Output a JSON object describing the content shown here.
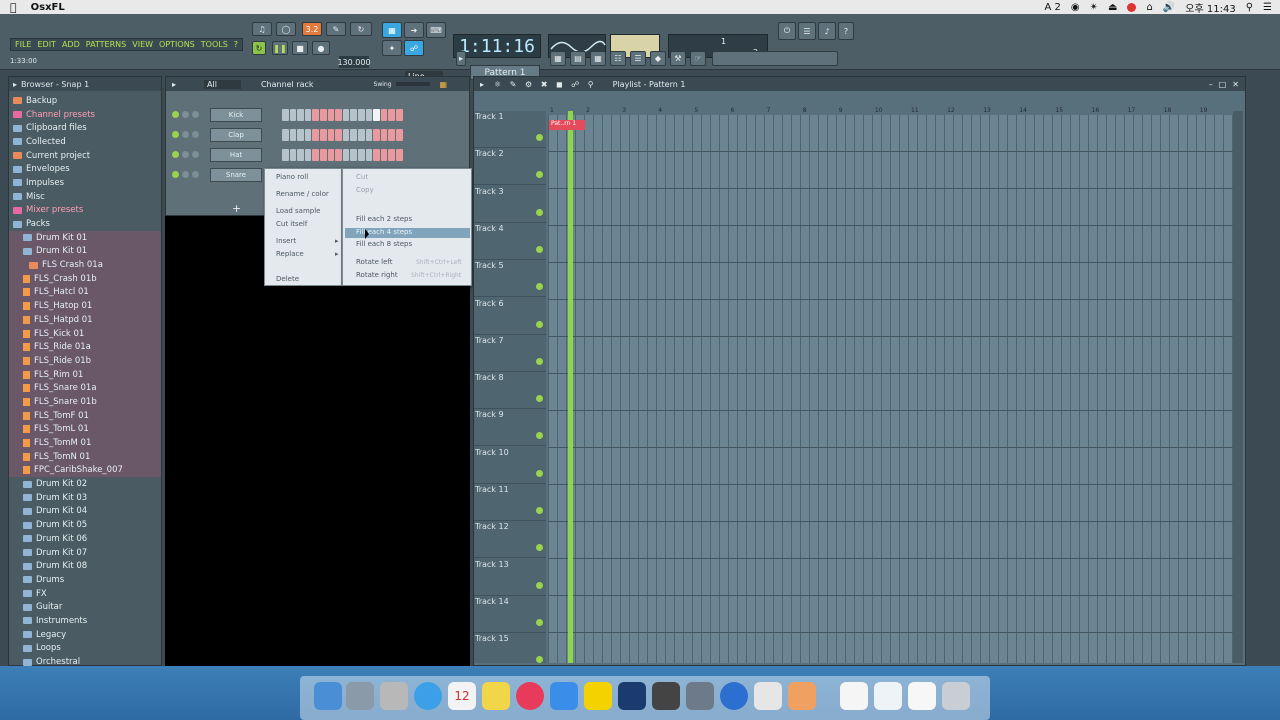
{
  "menubar": {
    "app_name": "OsxFL",
    "status_text": "A 2",
    "clock": "오후 11:43"
  },
  "toolbar": {
    "menu": [
      "FILE",
      "EDIT",
      "ADD",
      "PATTERNS",
      "VIEW",
      "OPTIONS",
      "TOOLS",
      "?"
    ],
    "hint": "1:33:00",
    "time": "1:11:16",
    "tempo": "130.000",
    "pattern": "Pattern 1",
    "snap": "Line",
    "cpu_digits": [
      "1",
      "2"
    ]
  },
  "browser": {
    "title": "Browser - Snap 1",
    "items": [
      {
        "label": "Backup",
        "type": "folder-o"
      },
      {
        "label": "Channel presets",
        "type": "folder-p",
        "hl": true
      },
      {
        "label": "Clipboard files",
        "type": "folder"
      },
      {
        "label": "Collected",
        "type": "folder"
      },
      {
        "label": "Current project",
        "type": "folder-o"
      },
      {
        "label": "Envelopes",
        "type": "folder"
      },
      {
        "label": "Impulses",
        "type": "folder"
      },
      {
        "label": "Misc",
        "type": "folder"
      },
      {
        "label": "Mixer presets",
        "type": "folder-p",
        "hl": true
      },
      {
        "label": "Packs",
        "type": "folder"
      },
      {
        "label": "Drum Kit 01",
        "type": "folder",
        "sub": 1,
        "pink": true
      },
      {
        "label": "Drum Kit 01",
        "type": "folder",
        "sub": 1,
        "pink": true
      },
      {
        "label": "FLS Crash 01a",
        "type": "folder-o",
        "sub": 2,
        "pink": true
      },
      {
        "label": "FLS_Crash 01b",
        "type": "sample",
        "sub": 1,
        "pink": true
      },
      {
        "label": "FLS_Hatcl 01",
        "type": "sample",
        "sub": 1,
        "pink": true
      },
      {
        "label": "FLS_Hatop 01",
        "type": "sample",
        "sub": 1,
        "pink": true
      },
      {
        "label": "FLS_Hatpd 01",
        "type": "sample",
        "sub": 1,
        "pink": true
      },
      {
        "label": "FLS_Kick 01",
        "type": "sample",
        "sub": 1,
        "pink": true
      },
      {
        "label": "FLS_Ride 01a",
        "type": "sample",
        "sub": 1,
        "pink": true
      },
      {
        "label": "FLS_Ride 01b",
        "type": "sample",
        "sub": 1,
        "pink": true
      },
      {
        "label": "FLS_Rim 01",
        "type": "sample",
        "sub": 1,
        "pink": true
      },
      {
        "label": "FLS_Snare 01a",
        "type": "sample",
        "sub": 1,
        "pink": true
      },
      {
        "label": "FLS_Snare 01b",
        "type": "sample",
        "sub": 1,
        "pink": true
      },
      {
        "label": "FLS_TomF 01",
        "type": "sample",
        "sub": 1,
        "pink": true
      },
      {
        "label": "FLS_TomL 01",
        "type": "sample",
        "sub": 1,
        "pink": true
      },
      {
        "label": "FLS_TomM 01",
        "type": "sample",
        "sub": 1,
        "pink": true
      },
      {
        "label": "FLS_TomN 01",
        "type": "sample",
        "sub": 1,
        "pink": true
      },
      {
        "label": "FPC_CaribShake_007",
        "type": "sample",
        "sub": 1,
        "pink": true
      },
      {
        "label": "Drum Kit 02",
        "type": "folder",
        "sub": 1
      },
      {
        "label": "Drum Kit 03",
        "type": "folder",
        "sub": 1
      },
      {
        "label": "Drum Kit 04",
        "type": "folder",
        "sub": 1
      },
      {
        "label": "Drum Kit 05",
        "type": "folder",
        "sub": 1
      },
      {
        "label": "Drum Kit 06",
        "type": "folder",
        "sub": 1
      },
      {
        "label": "Drum Kit 07",
        "type": "folder",
        "sub": 1
      },
      {
        "label": "Drum Kit 08",
        "type": "folder",
        "sub": 1
      },
      {
        "label": "Drums",
        "type": "folder",
        "sub": 1
      },
      {
        "label": "FX",
        "type": "folder",
        "sub": 1
      },
      {
        "label": "Guitar",
        "type": "folder",
        "sub": 1
      },
      {
        "label": "Instruments",
        "type": "folder",
        "sub": 1
      },
      {
        "label": "Legacy",
        "type": "folder",
        "sub": 1
      },
      {
        "label": "Loops",
        "type": "folder",
        "sub": 1
      },
      {
        "label": "Orchestral",
        "type": "folder",
        "sub": 1
      }
    ]
  },
  "channel_rack": {
    "filter": "All",
    "title": "Channel rack",
    "swing_label": "Swing",
    "add_label": "+",
    "channels": [
      {
        "name": "Kick"
      },
      {
        "name": "Clap"
      },
      {
        "name": "Hat"
      },
      {
        "name": "Snare"
      }
    ]
  },
  "context_menu": {
    "left": [
      "Piano roll",
      "Rename / color",
      "Load sample",
      "Cut itself",
      "Insert",
      "Replace",
      "Delete"
    ],
    "right": [
      {
        "label": "Cut",
        "shortcut": ""
      },
      {
        "label": "Copy",
        "shortcut": ""
      },
      {
        "label": "Fill each 2 steps",
        "shortcut": ""
      },
      {
        "label": "Fill each 4 steps",
        "shortcut": ""
      },
      {
        "label": "Fill each 8 steps",
        "shortcut": ""
      },
      {
        "label": "Rotate left",
        "shortcut": "Shift+Ctrl+Left"
      },
      {
        "label": "Rotate right",
        "shortcut": "Shift+Ctrl+Right"
      }
    ]
  },
  "playlist": {
    "title": "Playlist - Pattern 1",
    "clip_label": "Pat..rn 1",
    "ruler": [
      "1",
      "2",
      "3",
      "4",
      "5",
      "6",
      "7",
      "8",
      "9",
      "10",
      "11",
      "12",
      "13",
      "14",
      "15",
      "16",
      "17",
      "18",
      "19"
    ],
    "tracks": [
      "Track 1",
      "Track 2",
      "Track 3",
      "Track 4",
      "Track 5",
      "Track 6",
      "Track 7",
      "Track 8",
      "Track 9",
      "Track 10",
      "Track 11",
      "Track 12",
      "Track 13",
      "Track 14",
      "Track 15"
    ]
  },
  "dock": {
    "calendar_day": "12"
  }
}
